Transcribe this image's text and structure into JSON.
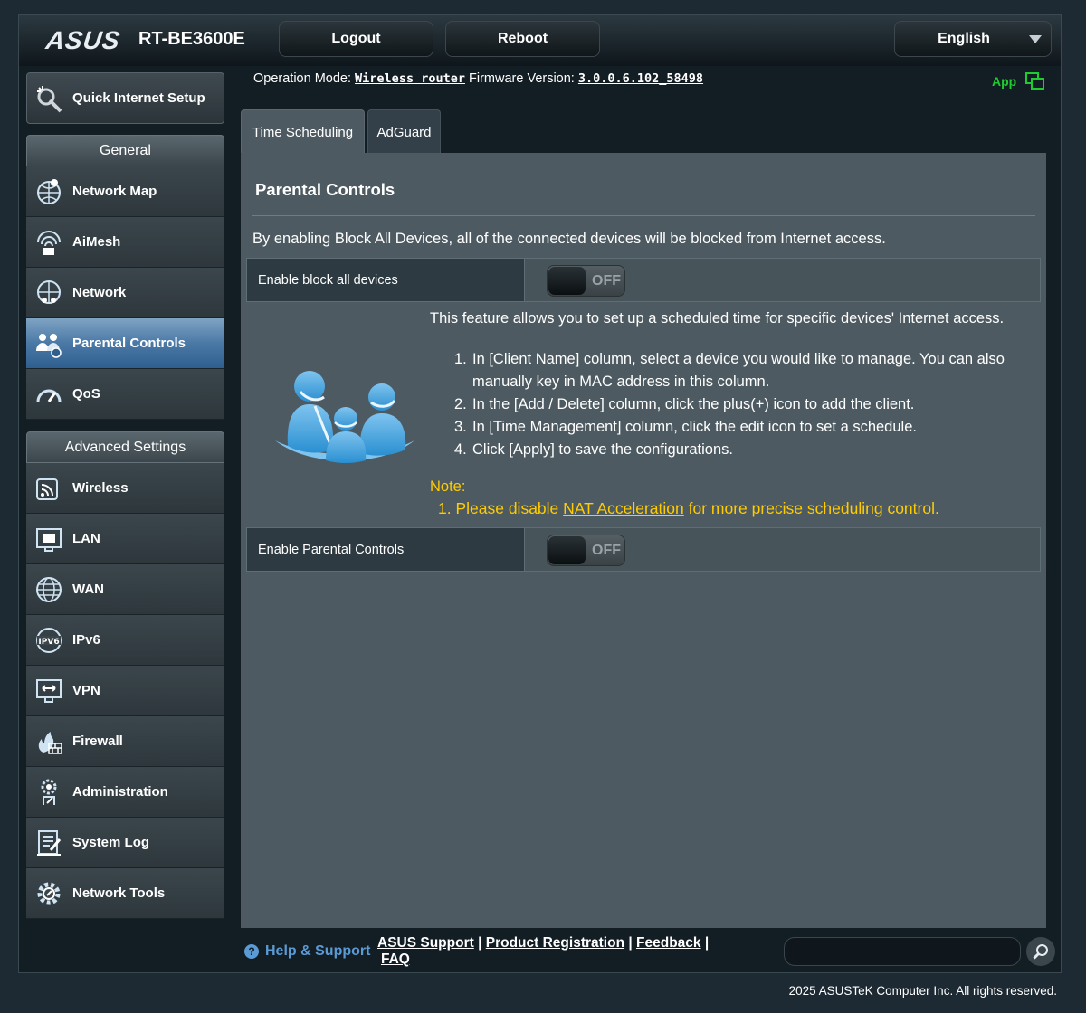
{
  "header": {
    "logo": "ASUS",
    "model": "RT-BE3600E",
    "logout_label": "Logout",
    "reboot_label": "Reboot",
    "language": "English"
  },
  "sidebar": {
    "quick_setup": "Quick Internet Setup",
    "general_header": "General",
    "general_items": [
      {
        "label": "Network Map",
        "icon": "network-map-icon"
      },
      {
        "label": "AiMesh",
        "icon": "aimesh-icon"
      },
      {
        "label": "Network",
        "icon": "network-icon"
      },
      {
        "label": "Parental Controls",
        "icon": "parental-controls-icon",
        "active": true
      },
      {
        "label": "QoS",
        "icon": "qos-icon"
      }
    ],
    "advanced_header": "Advanced Settings",
    "advanced_items": [
      {
        "label": "Wireless",
        "icon": "wireless-icon"
      },
      {
        "label": "LAN",
        "icon": "lan-icon"
      },
      {
        "label": "WAN",
        "icon": "wan-icon"
      },
      {
        "label": "IPv6",
        "icon": "ipv6-icon"
      },
      {
        "label": "VPN",
        "icon": "vpn-icon"
      },
      {
        "label": "Firewall",
        "icon": "firewall-icon"
      },
      {
        "label": "Administration",
        "icon": "administration-icon"
      },
      {
        "label": "System Log",
        "icon": "system-log-icon"
      },
      {
        "label": "Network Tools",
        "icon": "network-tools-icon"
      }
    ]
  },
  "info": {
    "operation_mode_label": "Operation Mode:",
    "operation_mode": "Wireless router",
    "firmware_label": "Firmware Version:",
    "firmware": "3.0.0.6.102_58498",
    "app_label": "App"
  },
  "tabs": [
    {
      "label": "Time Scheduling",
      "active": true
    },
    {
      "label": "AdGuard",
      "active": false
    }
  ],
  "panel": {
    "title": "Parental Controls",
    "block_description": "By enabling Block All Devices, all of the connected devices will be blocked from Internet access.",
    "block_label": "Enable block all devices",
    "block_state": "OFF",
    "feature_text": "This feature allows you to set up a scheduled time for specific devices' Internet access.",
    "steps": [
      {
        "num": "1.",
        "text": "In [Client Name] column, select a device you would like to manage. You can also manually key in MAC address in this column."
      },
      {
        "num": "2.",
        "text": "In the [Add / Delete] column, click the plus(+) icon to add the client."
      },
      {
        "num": "3.",
        "text": "In [Time Management] column, click the edit icon to set a schedule."
      },
      {
        "num": "4.",
        "text": "Click [Apply] to save the configurations."
      }
    ],
    "note_title": "Note:",
    "note_prefix": "1. Please disable ",
    "note_link": "NAT Acceleration",
    "note_suffix": " for more precise scheduling control.",
    "pc_label": "Enable Parental Controls",
    "pc_state": "OFF"
  },
  "footer": {
    "help_label": "Help & Support",
    "asus_support": "ASUS Support",
    "product_registration": "Product Registration",
    "feedback": "Feedback",
    "faq": "FAQ",
    "separator": "|",
    "copyright": "2025 ASUSTeK Computer Inc. All rights reserved."
  },
  "colors": {
    "accent_active": "#4a79a6",
    "note_yellow": "#ffcc00",
    "app_green": "#1fcc2f",
    "help_blue": "#5b9bd5"
  }
}
